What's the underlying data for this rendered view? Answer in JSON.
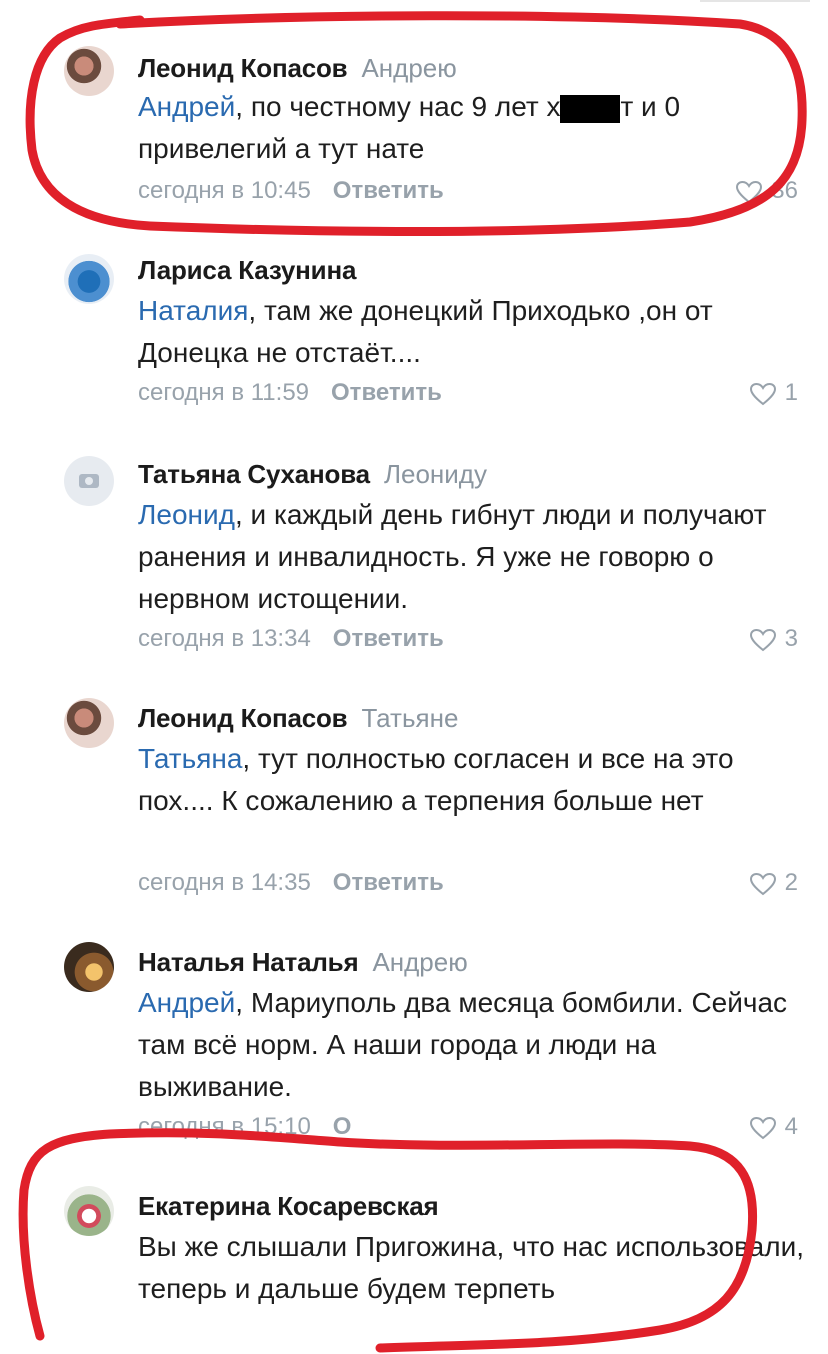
{
  "comments": [
    {
      "author": "Леонид Копасов",
      "reply_to": "Андрею",
      "mention": "Андрей",
      "text_before_censor": ", по честному нас 9 лет х",
      "text_after_censor": "т и 0 привелегий а тут нате",
      "time": "сегодня в 10:45",
      "reply_label": "Ответить",
      "likes": "36"
    },
    {
      "author": "Лариса Казунина",
      "reply_to": "",
      "mention": "Наталия",
      "text": ", там же донецкий Приходько ,он от Донецка не отстаёт....",
      "time": "сегодня в 11:59",
      "reply_label": "Ответить",
      "likes": "1"
    },
    {
      "author": "Татьяна Суханова",
      "reply_to": "Леониду",
      "mention": "Леонид",
      "text": ", и каждый день гибнут люди и получают ранения и инвалидность. Я уже не говорю о нервном истощении.",
      "time": "сегодня в 13:34",
      "reply_label": "Ответить",
      "likes": "3"
    },
    {
      "author": "Леонид Копасов",
      "reply_to": "Татьяне",
      "mention": "Татьяна",
      "text": ", тут полностью согласен и все на это пох.... К сожалению а терпения больше нет",
      "time": "сегодня в 14:35",
      "reply_label": "Ответить",
      "likes": "2"
    },
    {
      "author": "Наталья Наталья",
      "reply_to": "Андрею",
      "mention": "Андрей",
      "text": ", Мариуполь два месяца бомбили. Сейчас там всё норм. А наши города и люди на выживание.",
      "time": "сегодня в 15:10",
      "reply_label": "О",
      "likes": "4"
    },
    {
      "author": "Екатерина Косаревская",
      "reply_to": "",
      "mention": "",
      "text": "Вы же слышали Пригожина, что нас использовали, теперь и дальше будем терпеть"
    }
  ],
  "colors": {
    "mention": "#2a6ab0",
    "meta": "#98a2ab",
    "annotation": "#e0202a"
  },
  "icons": [
    "heart-icon",
    "avatar-photo",
    "camera-placeholder-icon"
  ]
}
